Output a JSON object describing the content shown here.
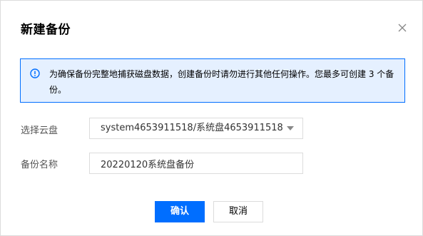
{
  "dialog": {
    "title": "新建备份",
    "close_icon": "close-icon"
  },
  "alert": {
    "icon": "info-circle-icon",
    "text": "为确保备份完整地捕获磁盘数据，创建备份时请勿进行其他任何操作。您最多可创建 3 个备份。"
  },
  "form": {
    "cloud_disk_label": "选择云盘",
    "cloud_disk_value": "system4653911518/系统盘4653911518",
    "backup_name_label": "备份名称",
    "backup_name_value": "20220120系统盘备份"
  },
  "buttons": {
    "confirm": "确认",
    "cancel": "取消"
  },
  "colors": {
    "primary": "#006eff",
    "alert_bg": "#e5f0ff",
    "border": "#dcdcdc"
  }
}
